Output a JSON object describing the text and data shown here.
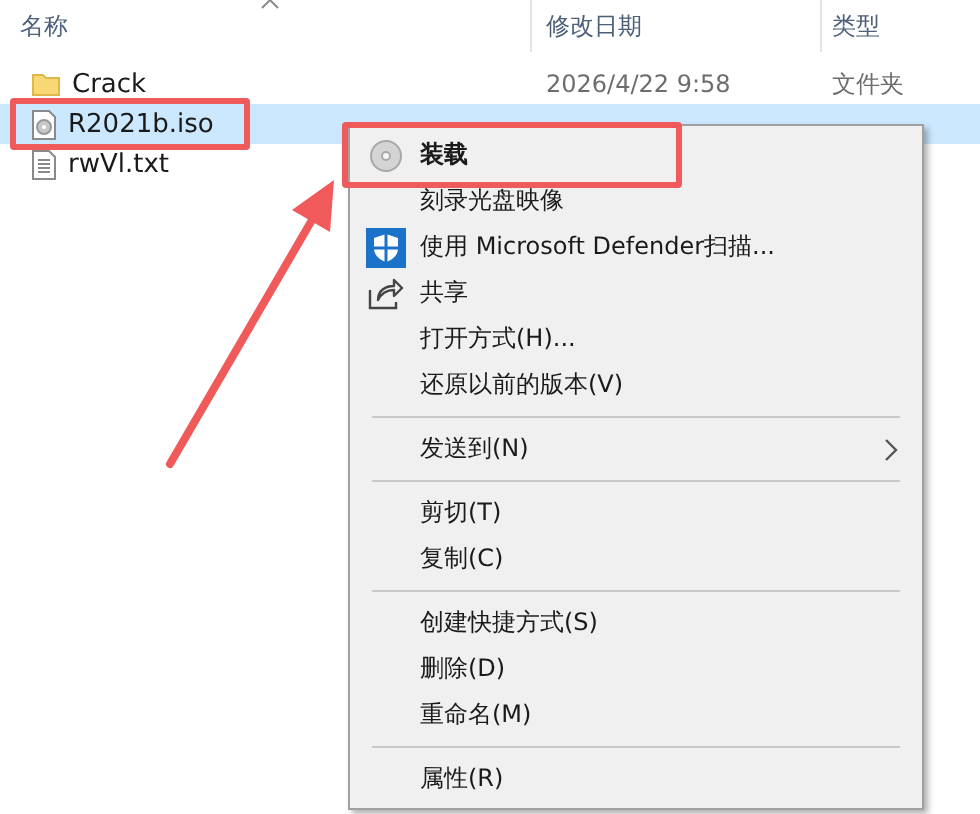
{
  "columns": [
    {
      "label": "名称"
    },
    {
      "label": "修改日期"
    },
    {
      "label": "类型"
    }
  ],
  "files": [
    {
      "kind": "folder",
      "name": "Crack",
      "date": "2026/4/22 9:58",
      "type": "文件夹",
      "selected": false,
      "marked": false
    },
    {
      "kind": "disc",
      "name": "R2021b.iso",
      "selected": true,
      "marked": true
    },
    {
      "kind": "text",
      "name": "rwVl.txt",
      "selected": false,
      "marked": false
    }
  ],
  "context_menu": [
    {
      "kind": "disc",
      "label": "装载",
      "default": true,
      "marked": true
    },
    {
      "kind": "plain",
      "label": "刻录光盘映像",
      "default": false,
      "marked": false
    },
    {
      "kind": "shield",
      "label": "使用 Microsoft Defender扫描...",
      "default": false,
      "marked": false
    },
    {
      "kind": "share",
      "label": "共享",
      "default": false,
      "marked": false
    },
    {
      "kind": "plain",
      "label": "打开方式(H)...",
      "default": false,
      "marked": false
    },
    {
      "kind": "plain",
      "label": "还原以前的版本(V)",
      "default": false,
      "marked": false
    },
    {
      "kind": "separator"
    },
    {
      "kind": "submenu",
      "label": "发送到(N)",
      "default": false,
      "marked": false
    },
    {
      "kind": "separator"
    },
    {
      "kind": "plain",
      "label": "剪切(T)",
      "default": false,
      "marked": false
    },
    {
      "kind": "plain",
      "label": "复制(C)",
      "default": false,
      "marked": false
    },
    {
      "kind": "separator"
    },
    {
      "kind": "plain",
      "label": "创建快捷方式(S)",
      "default": false,
      "marked": false
    },
    {
      "kind": "plain",
      "label": "删除(D)",
      "default": false,
      "marked": false
    },
    {
      "kind": "plain",
      "label": "重命名(M)",
      "default": false,
      "marked": false
    },
    {
      "kind": "separator"
    },
    {
      "kind": "plain",
      "label": "属性(R)",
      "default": false,
      "marked": false
    }
  ]
}
